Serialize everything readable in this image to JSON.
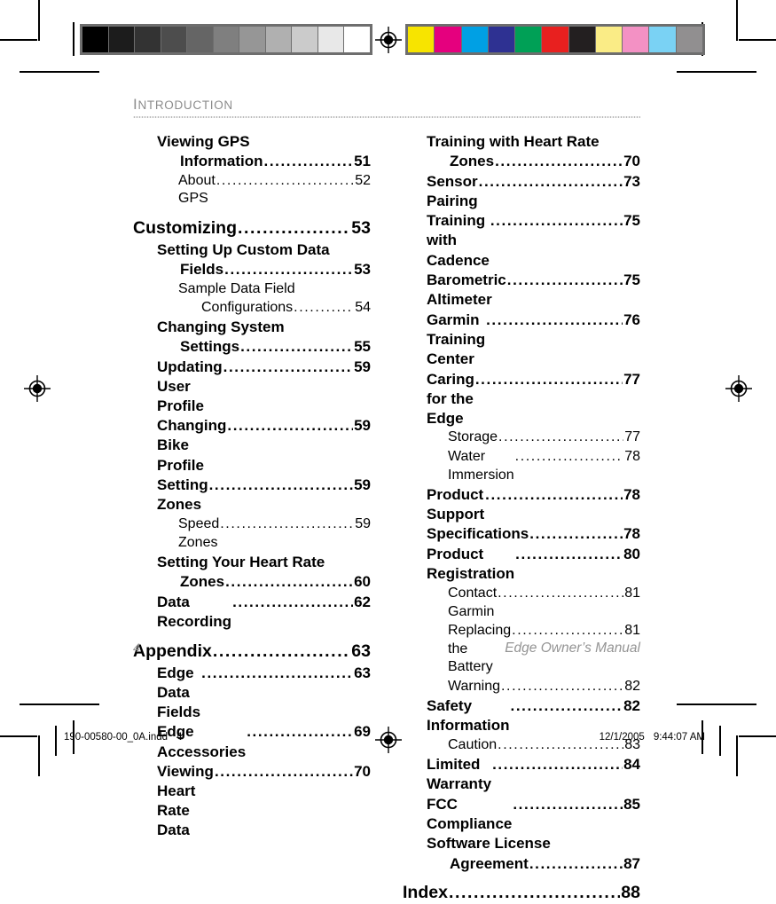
{
  "document": {
    "running_head": "Introduction",
    "footer_page_number": "4",
    "footer_manual_title": "Edge Owner’s Manual"
  },
  "printer_slug": {
    "filename": "190-00580-00_0A.indd",
    "page": "4",
    "date": "12/1/2005",
    "time": "9:44:07 AM"
  },
  "calibration": {
    "gray_bar_label": "grayscale-step-wedge",
    "gray_steps": [
      "#000000",
      "#1c1c1c",
      "#333333",
      "#4d4d4d",
      "#656565",
      "#7f7f7f",
      "#969696",
      "#b0b0b0",
      "#cbcbcb",
      "#e8e8e8",
      "#ffffff"
    ],
    "color_bar_label": "process-color-patches",
    "color_patches": [
      "#f7e400",
      "#e5007e",
      "#00a0e4",
      "#2e3192",
      "#00a056",
      "#e8201f",
      "#231f20",
      "#faec86",
      "#f391c4",
      "#7ad2f4",
      "#918f90"
    ]
  },
  "toc": {
    "left_column": [
      {
        "level": 2,
        "title_line1": "Viewing GPS",
        "title_line2": "Information",
        "page": "51",
        "group_start": false
      },
      {
        "level": 3,
        "title_line1": "About GPS",
        "page": "52",
        "group_start": false
      },
      {
        "level": 1,
        "title_line1": "Customizing",
        "page": "53",
        "group_start": true
      },
      {
        "level": 2,
        "title_line1": "Setting Up Custom Data",
        "title_line2": "Fields",
        "page": "53",
        "group_start": false
      },
      {
        "level": 3,
        "title_line1": "Sample Data Field",
        "title_line2": "Configurations",
        "page": "54",
        "group_start": false
      },
      {
        "level": 2,
        "title_line1": "Changing System",
        "title_line2": "Settings",
        "page": "55",
        "group_start": false
      },
      {
        "level": 2,
        "title_line1": "Updating User Profile",
        "page": "59",
        "group_start": false
      },
      {
        "level": 2,
        "title_line1": "Changing Bike Profile",
        "page": "59",
        "group_start": false
      },
      {
        "level": 2,
        "title_line1": "Setting Zones",
        "page": "59",
        "group_start": false
      },
      {
        "level": 3,
        "title_line1": "Speed Zones",
        "page": "59",
        "group_start": false
      },
      {
        "level": 2,
        "title_line1": "Setting Your Heart Rate",
        "title_line2": "Zones ",
        "page": "60",
        "group_start": false
      },
      {
        "level": 2,
        "title_line1": "Data Recording",
        "page": "62",
        "group_start": false
      },
      {
        "level": 1,
        "title_line1": "Appendix ",
        "page": "63",
        "group_start": true
      },
      {
        "level": 2,
        "title_line1": "Edge Data Fields ",
        "page": "63",
        "group_start": false
      },
      {
        "level": 2,
        "title_line1": "Edge Accessories",
        "page": "69",
        "group_start": false
      },
      {
        "level": 2,
        "title_line1": "Viewing Heart Rate Data",
        "page": "70",
        "group_start": false
      }
    ],
    "right_column": [
      {
        "level": 2,
        "title_line1": "Training with Heart Rate",
        "title_line2": "Zones",
        "page": "70",
        "group_start": false
      },
      {
        "level": 2,
        "title_line1": "Sensor Pairing",
        "page": "73",
        "group_start": false
      },
      {
        "level": 2,
        "title_line1": "Training with Cadence ",
        "page": "75",
        "group_start": false
      },
      {
        "level": 2,
        "title_line1": "Barometric Altimeter",
        "page": "75",
        "group_start": false
      },
      {
        "level": 2,
        "title_line1": "Garmin Training Center ",
        "page": "76",
        "group_start": false
      },
      {
        "level": 2,
        "title_line1": "Caring for the Edge",
        "page": "77",
        "group_start": false
      },
      {
        "level": 3,
        "title_line1": "Storage",
        "page": "77",
        "group_start": false
      },
      {
        "level": 3,
        "title_line1": "Water Immersion",
        "page": "78",
        "group_start": false
      },
      {
        "level": 2,
        "title_line1": "Product Support",
        "page": "78",
        "group_start": false
      },
      {
        "level": 2,
        "title_line1": "Specifications  ",
        "page": "78",
        "group_start": false
      },
      {
        "level": 2,
        "title_line1": "Product Registration",
        "page": "80",
        "group_start": false
      },
      {
        "level": 3,
        "title_line1": "Contact Garmin",
        "page": "81",
        "group_start": false
      },
      {
        "level": 3,
        "title_line1": "Replacing the Battery ",
        "page": "81",
        "group_start": false
      },
      {
        "level": 3,
        "title_line1": "Warning",
        "page": "82",
        "group_start": false
      },
      {
        "level": 2,
        "title_line1": "Safety Information",
        "page": "82",
        "group_start": false
      },
      {
        "level": 3,
        "title_line1": "Caution ",
        "page": "83",
        "group_start": false
      },
      {
        "level": 2,
        "title_line1": "Limited Warranty ",
        "page": "84",
        "group_start": false
      },
      {
        "level": 2,
        "title_line1": "FCC Compliance",
        "page": "85",
        "group_start": false
      },
      {
        "level": 2,
        "title_line1": "Software License",
        "title_line2": "Agreement",
        "page": "87",
        "group_start": false
      },
      {
        "level": 1,
        "title_line1": "Index ",
        "page": "88",
        "group_start": false
      }
    ]
  }
}
